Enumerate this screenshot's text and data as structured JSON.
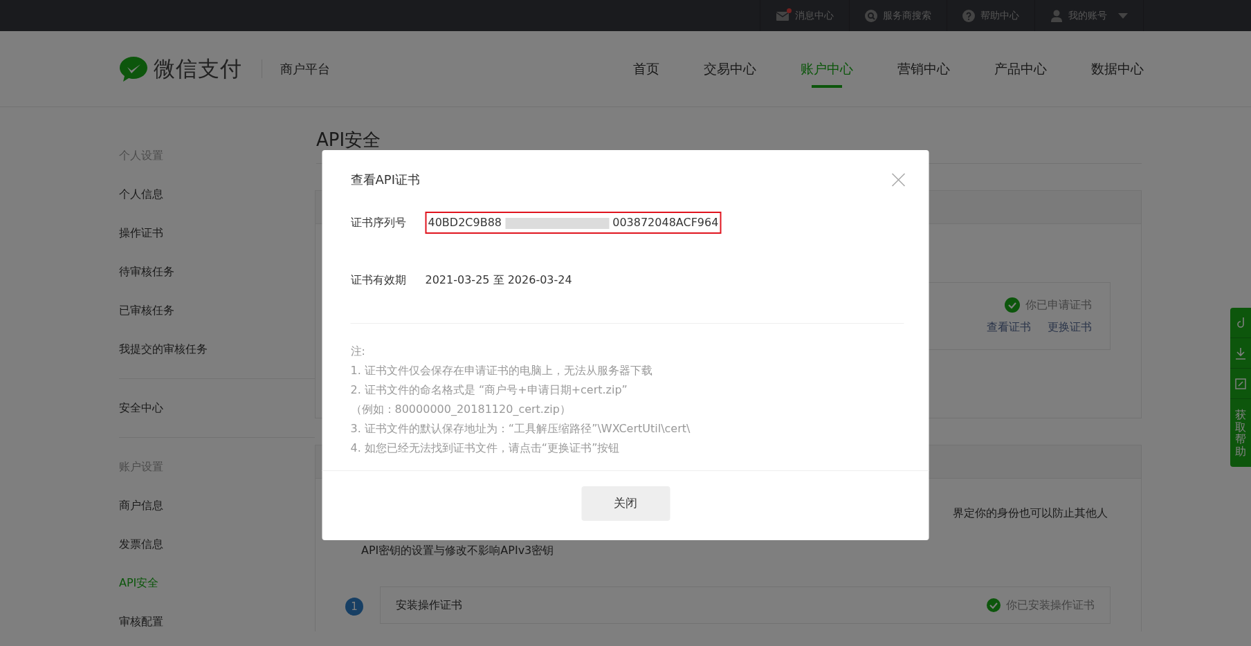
{
  "top_bar": {
    "items": [
      {
        "kind": "message",
        "label": "消息中心",
        "unread": true
      },
      {
        "kind": "search",
        "label": "服务商搜索",
        "unread": false
      },
      {
        "kind": "help",
        "label": "帮助中心",
        "unread": false
      },
      {
        "kind": "account",
        "label": "我的账号",
        "unread": false
      }
    ]
  },
  "header": {
    "logo_text": "微信支付",
    "platform": "商户平台",
    "nav": [
      {
        "label": "首页",
        "selected": false
      },
      {
        "label": "交易中心",
        "selected": false
      },
      {
        "label": "账户中心",
        "selected": true
      },
      {
        "label": "营销中心",
        "selected": false
      },
      {
        "label": "产品中心",
        "selected": false
      },
      {
        "label": "数据中心",
        "selected": false
      }
    ]
  },
  "sidebar": {
    "groups": [
      {
        "heading": "个人设置",
        "items": [
          {
            "label": "个人信息",
            "selected": false
          },
          {
            "label": "操作证书",
            "selected": false
          },
          {
            "label": "待审核任务",
            "selected": false
          },
          {
            "label": "已审核任务",
            "selected": false
          },
          {
            "label": "我提交的审核任务",
            "selected": false
          }
        ]
      },
      {
        "items": [
          {
            "label": "安全中心",
            "selected": false
          }
        ]
      },
      {
        "heading": "账户设置",
        "items": [
          {
            "label": "商户信息",
            "selected": false
          },
          {
            "label": "发票信息",
            "selected": false
          },
          {
            "label": "API安全",
            "selected": true
          },
          {
            "label": "审核配置",
            "selected": false
          }
        ]
      }
    ]
  },
  "page": {
    "title": "API安全",
    "cert_card": {
      "status": "你已申请证书",
      "links": [
        "查看证书",
        "更换证书"
      ]
    },
    "key_card": {
      "lines": [
        "界定你的身份也可以防止其他人",
        "API密钥的设置与修改不影响APIv3密钥"
      ]
    },
    "steps": [
      {
        "number": "1",
        "title": "安装操作证书",
        "status": "你已安装操作证书"
      }
    ]
  },
  "help_tab": {
    "label": "获取帮助"
  },
  "dialog": {
    "title": "查看API证书",
    "fields": [
      {
        "kind": "redacted",
        "label": "证书序列号",
        "value_start": "40BD2C9B88",
        "value_end": "003872048ACF964",
        "highlighted": true
      },
      {
        "kind": "plain",
        "label": "证书有效期",
        "value": "2021-03-25 至 2026-03-24",
        "highlighted": false
      }
    ],
    "notes_heading": "注:",
    "notes": [
      "1. 证书文件仅会保存在申请证书的电脑上，无法从服务器下载",
      "2. 证书文件的命名格式是 “商户号+申请日期+cert.zip”",
      "（例如：80000000_20181120_cert.zip）",
      "3. 证书文件的默认保存地址为：“工具解压缩路径”\\WXCertUtil\\cert\\",
      "4. 如您已经无法找到证书文件，请点击“更换证书”按钮"
    ],
    "close_button": "关闭"
  }
}
